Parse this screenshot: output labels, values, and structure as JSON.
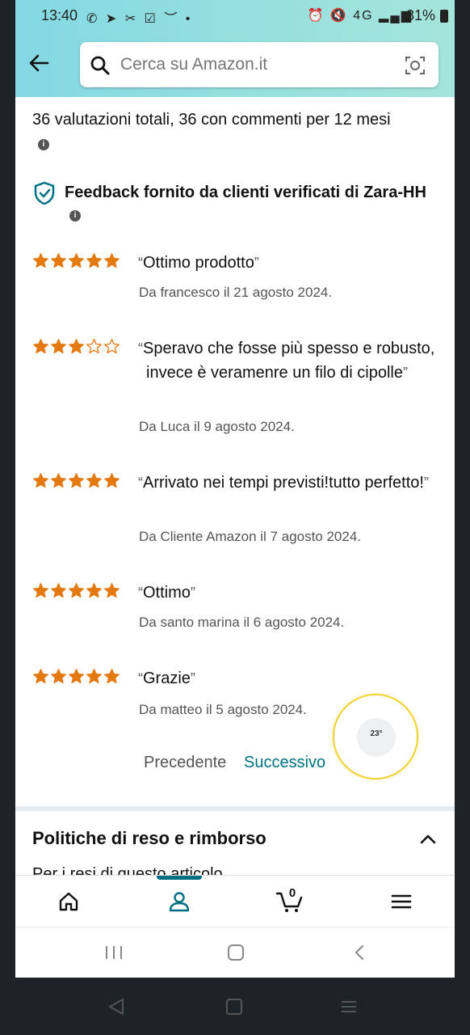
{
  "status_bar": {
    "time": "13:40",
    "left_icons": "✆ ➤ ✂ ☑ ︶ •",
    "right_icons": "⏰ 🔇 4G ▂▄▆",
    "battery": "81%"
  },
  "search": {
    "placeholder": "Cerca su Amazon.it"
  },
  "summary": {
    "text": "36 valutazioni totali, 36 con commenti per 12 mesi"
  },
  "verified": {
    "text": "Feedback fornito da clienti verificati di Zara-HH"
  },
  "reviews": [
    {
      "rating": 5,
      "text": "Ottimo prodotto",
      "by": "Da francesco il 21 agosto 2024."
    },
    {
      "rating": 3,
      "text": "Speravo che fosse più spesso e robusto, invece è veramenre un filo di cipolle",
      "by": "Da Luca il 9 agosto 2024."
    },
    {
      "rating": 5,
      "text": "Arrivato nei tempi previsti!tutto perfetto!",
      "by": "Da Cliente Amazon il 7 agosto 2024."
    },
    {
      "rating": 5,
      "text": "Ottimo",
      "by": "Da santo marina il 6 agosto 2024."
    },
    {
      "rating": 5,
      "text": "Grazie",
      "by": "Da matteo il 5 agosto 2024."
    }
  ],
  "pagination": {
    "prev": "Precedente",
    "next": "Successivo"
  },
  "float_button": {
    "text": "23°"
  },
  "policy": {
    "title": "Politiche di reso e rimborso",
    "cut_text": "Per i resi di questo articolo"
  },
  "bottom_nav": {
    "cart_count": "0"
  },
  "colors": {
    "star": "#e47911",
    "link": "#007185",
    "header": "#84d8e3"
  }
}
